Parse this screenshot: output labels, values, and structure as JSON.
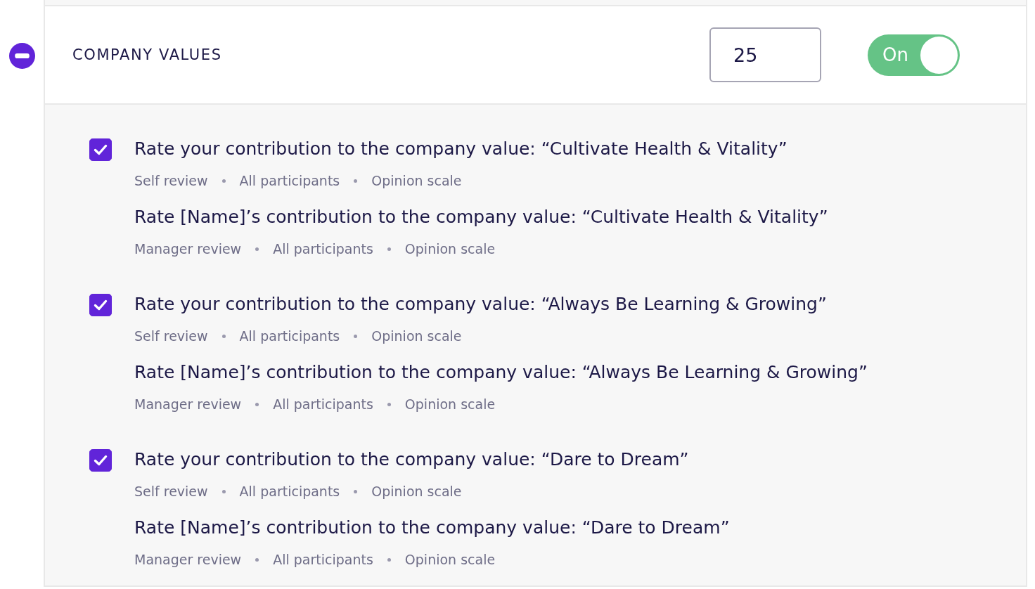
{
  "section": {
    "expanded": true,
    "title": "COMPANY VALUES",
    "weight": "25",
    "toggle": {
      "on": true,
      "label": "On"
    }
  },
  "groups": [
    {
      "checked": true,
      "questions": [
        {
          "text": "Rate your contribution to the company value: “Cultivate Health & Vitality”",
          "meta": [
            "Self review",
            "All participants",
            "Opinion scale"
          ]
        },
        {
          "text": "Rate [Name]’s contribution to the company value: “Cultivate Health & Vitality”",
          "meta": [
            "Manager review",
            "All participants",
            "Opinion scale"
          ]
        }
      ]
    },
    {
      "checked": true,
      "questions": [
        {
          "text": "Rate your contribution to the company value: “Always Be Learning & Growing”",
          "meta": [
            "Self review",
            "All participants",
            "Opinion scale"
          ]
        },
        {
          "text": "Rate [Name]’s contribution to the company value: “Always Be Learning & Growing”",
          "meta": [
            "Manager review",
            "All participants",
            "Opinion scale"
          ]
        }
      ]
    },
    {
      "checked": true,
      "questions": [
        {
          "text": "Rate your contribution to the company value: “Dare to Dream”",
          "meta": [
            "Self review",
            "All participants",
            "Opinion scale"
          ]
        },
        {
          "text": "Rate [Name]’s contribution to the company value: “Dare to Dream”",
          "meta": [
            "Manager review",
            "All participants",
            "Opinion scale"
          ]
        }
      ]
    }
  ]
}
